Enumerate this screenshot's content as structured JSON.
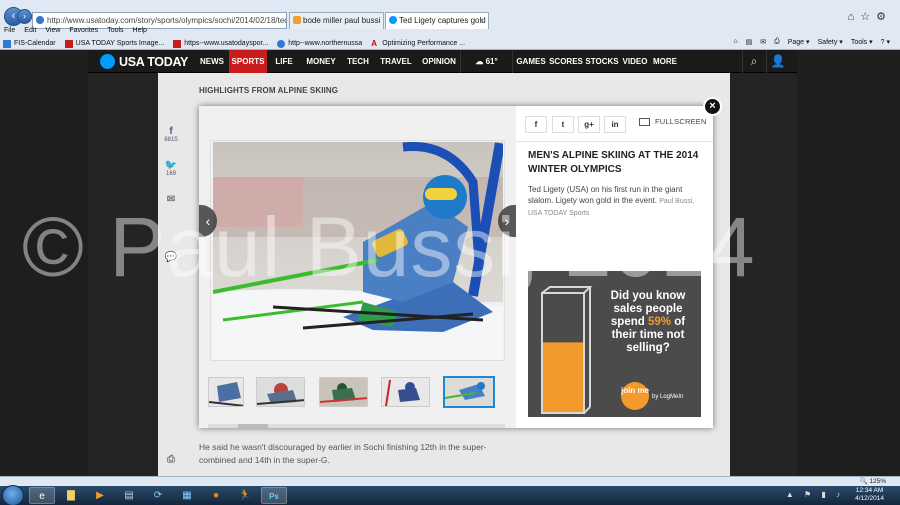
{
  "browser": {
    "address": "http://www.usatoday.com/story/sports/olympics/sochi/2014/02/18/ted-ligety-skiing-gi",
    "tabs": [
      {
        "label": "bode miller paul bussi - Bing I...",
        "fav_color": "#f0a030"
      },
      {
        "label": "Ted Ligety captures gold m...",
        "fav_color": "#009bff"
      }
    ],
    "menu": [
      "File",
      "Edit",
      "View",
      "Favorites",
      "Tools",
      "Help"
    ],
    "favorites": [
      "FIS-Calendar",
      "USA TODAY Sports Image...",
      "https--www.usatodayspor...",
      "http--www.northernussa",
      "Optimizing Performance ..."
    ],
    "commands": [
      "Page ▾",
      "Safety ▾",
      "Tools ▾",
      "? ▾"
    ]
  },
  "site": {
    "logo": "USA TODAY",
    "nav": [
      "NEWS",
      "SPORTS",
      "LIFE",
      "MONEY",
      "TECH",
      "TRAVEL",
      "OPINION",
      "GAMES",
      "SCORES",
      "STOCKS",
      "VIDEO",
      "MORE"
    ],
    "weather": "61°",
    "section_heading": "HIGHLIGHTS FROM ALPINE SKIING",
    "share_counts": {
      "facebook": "6815",
      "twitter": "169"
    },
    "body_text": "He said he wasn't discouraged by earlier in Sochi finishing 12th in the super-combined and 14th in the super-G."
  },
  "gallery": {
    "fullscreen_label": "FULLSCREEN",
    "caption_title": "MEN'S ALPINE SKIING AT THE 2014 WINTER OLYMPICS",
    "caption_text": "Ted Ligety (USA) on his first run in the giant slalom. Ligety won gold in the event.",
    "caption_credit": "Paul Bussi, USA TODAY Sports",
    "active_thumb": 5
  },
  "ad": {
    "line1": "Did you know sales people spend",
    "percent": "59%",
    "line2": "of their time not selling?",
    "join": "join me",
    "by": "by LogMeIn",
    "bar_fill": 0.59
  },
  "watermark": "© Paul Bussi, 2014",
  "status": {
    "zoom": "125%",
    "time": "12:34 AM",
    "date": "4/12/2014"
  },
  "colors": {
    "brand": "#009bff",
    "sports_red": "#c91c1c",
    "ad_orange": "#f39a2d",
    "thumb_active": "#1a8ad6"
  }
}
